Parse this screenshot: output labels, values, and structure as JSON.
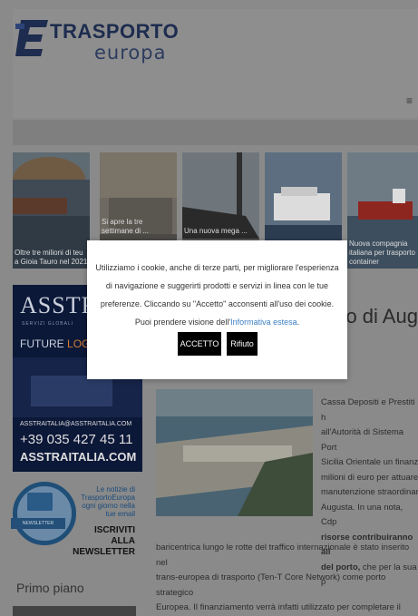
{
  "header": {
    "logo_title": "TRASPORTO",
    "logo_subtitle": "europa",
    "menu_icon": "≡"
  },
  "thumbs": [
    {
      "caption": "Oltre tre milioni di teu a Gioia Tauro nel 2021"
    },
    {
      "caption": "Si apre la tre settimane di ..."
    },
    {
      "caption": "Una nuova mega ..."
    },
    {
      "caption": ""
    },
    {
      "caption": "Nuova compagnia italiana per trasporto container"
    }
  ],
  "sidebar_ad": {
    "brand": "ASSTRA",
    "brand_sub": "SERVIZI GLOBALI",
    "tagline_a": "FUTURE",
    "tagline_b": "LOGIST",
    "email": "ASSTRAITALIA@ASSTRAITALIA.COM",
    "phone": "+39 035 427 45 11",
    "site": "ASSTRAITALIA.COM"
  },
  "newsletter": {
    "badge": "NEWSLETTER",
    "small_text": "Le notizie di TrasportoEuropa ogni giorno nella tue email",
    "big_text": "ISCRIVITI\nALLA\nNEWSLETTER"
  },
  "primo_piano": "Primo piano",
  "article": {
    "title": "rto di Aug",
    "side_text": "Cassa Depositi e Prestiti h\nall'Autorità di Sistema Port\nSicilia Orientale un finanzi\nmilioni di euro per attuare\nmanutenzione straordinari\nAugusta. In una nota, Cdp",
    "bold_text": "risorse contribuiranno all",
    "bold_text_2": "del porto,",
    "bold_tail": " che per la sua p",
    "full_text": "baricentrica lungo le rotte del traffico internazionale è stato inserito nel\ntrans-europea di trasporto (Ten-T Core Network) come porto strategico\nEuropea. Il finanziamento verrà infatti utilizzato per completare il rinforzo\nstatico della diga foranea del porto di Augusta, situata nel lato nord e r\ndanneggiato."
  },
  "cookie": {
    "text": "Utilizziamo i cookie, anche di terze parti, per migliorare l'esperienza di navigazione e suggerirti prodotti e servizi in linea con le tue preferenze. Cliccando su \"Accetto\" acconsenti all'uso dei cookie. Puoi prendere visione dell'",
    "link_text": "Informativa estesa",
    "link_suffix": ".",
    "accept_label": "ACCETTO",
    "reject_label": "Rifiuto"
  }
}
